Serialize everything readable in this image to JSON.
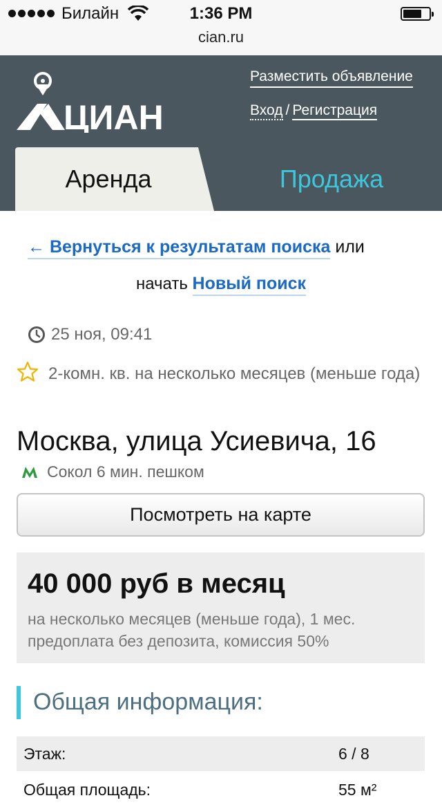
{
  "status_bar": {
    "carrier": "Билайн",
    "time": "1:36 PM"
  },
  "url_bar": {
    "domain": "cian.ru"
  },
  "header": {
    "logo_text": "ЦИАН",
    "post_ad": "Разместить объявление",
    "login": "Вход",
    "separator": "/",
    "register": "Регистрация",
    "tabs": [
      {
        "label": "Аренда",
        "active": true
      },
      {
        "label": "Продажа",
        "active": false
      }
    ]
  },
  "nav": {
    "back_link": "← Вернуться к результатам поиска",
    "or": "или",
    "start": "начать",
    "new_search": "Новый поиск"
  },
  "listing": {
    "date": "25 ноя, 09:41",
    "type": "2-комн. кв. на несколько месяцев (меньше года)",
    "address": "Москва, улица Усиевича, 16",
    "metro": "Сокол 6 мин. пешком",
    "map_button": "Посмотреть на карте",
    "price": "40 000 руб в месяц",
    "price_details": "на несколько месяцев (меньше года), 1 мес. предоплата без депозита, комиссия 50%"
  },
  "general_info": {
    "title": "Общая информация:",
    "rows": [
      {
        "label": "Этаж:",
        "value": "6 / 8"
      },
      {
        "label": "Общая площадь:",
        "value": "55 м²"
      }
    ]
  },
  "colors": {
    "header_bg": "#4b575e",
    "accent": "#3ec6dc",
    "link": "#1a6ac5",
    "metro": "#2e9b3e",
    "star": "#f0b400"
  }
}
